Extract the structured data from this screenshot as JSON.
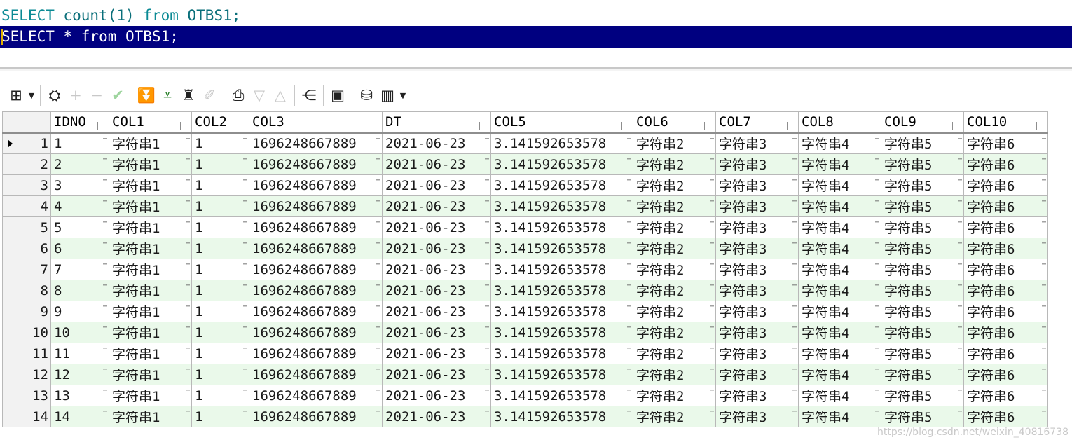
{
  "editor": {
    "line1": {
      "kw1": "SELECT",
      "mid": " count(1) ",
      "kw2": "from",
      "rest": " OTBS1;"
    },
    "line2": {
      "text": "SELECT * from OTBS1;"
    }
  },
  "toolbar": {
    "buttons": [
      {
        "name": "grid-menu-icon",
        "glyph": "⊞"
      },
      {
        "name": "lock-icon",
        "glyph": "🔒"
      },
      {
        "name": "add-record-icon",
        "glyph": "+"
      },
      {
        "name": "delete-record-icon",
        "glyph": "−"
      },
      {
        "name": "post-changes-icon",
        "glyph": "✓"
      },
      {
        "name": "fetch-next-page-icon",
        "glyph": "⏬"
      },
      {
        "name": "fetch-all-icon",
        "glyph": "⩡"
      },
      {
        "name": "find-binoculars-icon",
        "glyph": "⚲"
      },
      {
        "name": "clear-filter-icon",
        "glyph": "⌫"
      },
      {
        "name": "query-by-example-icon",
        "glyph": "⎙"
      },
      {
        "name": "sort-desc-icon",
        "glyph": "▽"
      },
      {
        "name": "sort-asc-icon",
        "glyph": "△"
      },
      {
        "name": "explain-plan-icon",
        "glyph": "⋲"
      },
      {
        "name": "save-icon",
        "glyph": "▣"
      },
      {
        "name": "export-icon",
        "glyph": "⛁"
      },
      {
        "name": "chart-icon",
        "glyph": "▥"
      }
    ]
  },
  "grid": {
    "columns": [
      "IDNO",
      "COL1",
      "COL2",
      "COL3",
      "DT",
      "COL5",
      "COL6",
      "COL7",
      "COL8",
      "COL9",
      "COL10"
    ],
    "row_template": {
      "COL1": "字符串1",
      "COL2": "1",
      "COL3": "1696248667889",
      "DT": "2021-06-23",
      "COL5": "3.141592653578",
      "COL6": "字符串2",
      "COL7": "字符串3",
      "COL8": "字符串4",
      "COL9": "字符串5",
      "COL10": "字符串6"
    },
    "rows": [
      {
        "rownum": "1",
        "IDNO": "1"
      },
      {
        "rownum": "2",
        "IDNO": "2"
      },
      {
        "rownum": "3",
        "IDNO": "3"
      },
      {
        "rownum": "4",
        "IDNO": "4"
      },
      {
        "rownum": "5",
        "IDNO": "5"
      },
      {
        "rownum": "6",
        "IDNO": "6"
      },
      {
        "rownum": "7",
        "IDNO": "7"
      },
      {
        "rownum": "8",
        "IDNO": "8"
      },
      {
        "rownum": "9",
        "IDNO": "9"
      },
      {
        "rownum": "10",
        "IDNO": "10"
      },
      {
        "rownum": "11",
        "IDNO": "11"
      },
      {
        "rownum": "12",
        "IDNO": "12"
      },
      {
        "rownum": "13",
        "IDNO": "13"
      },
      {
        "rownum": "14",
        "IDNO": "14"
      }
    ],
    "current_row": 1
  },
  "watermark": "https://blog.csdn.net/weixin_40816738"
}
